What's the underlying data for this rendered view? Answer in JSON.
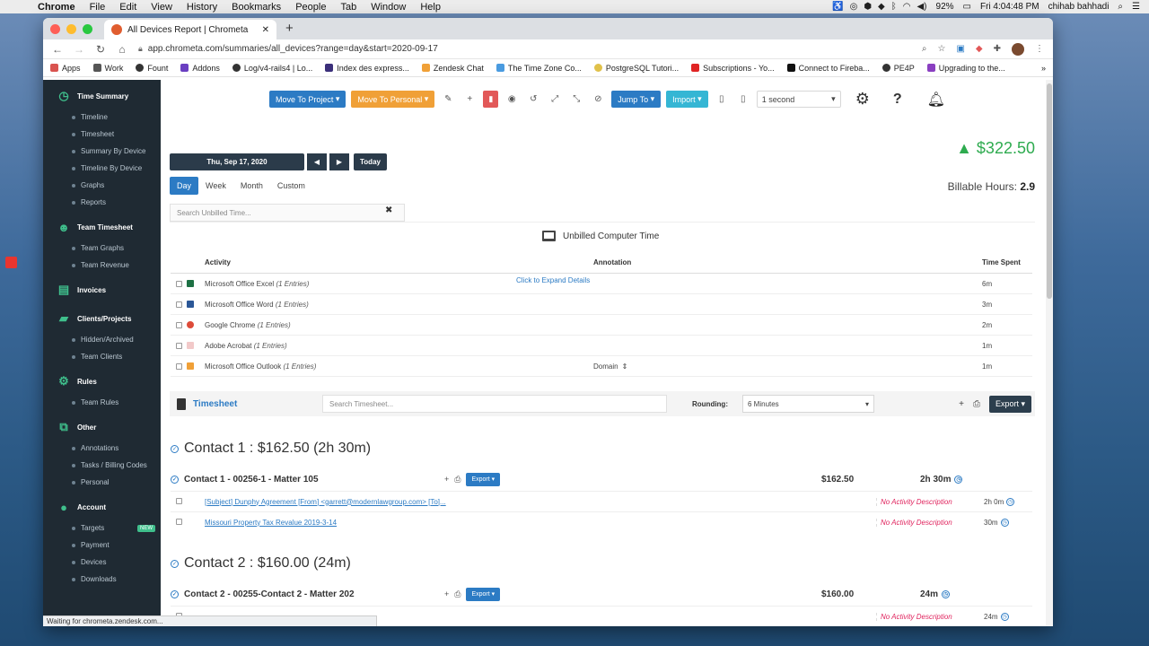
{
  "menubar": {
    "app": "Chrome",
    "items": [
      "File",
      "Edit",
      "View",
      "History",
      "Bookmarks",
      "People",
      "Tab",
      "Window",
      "Help"
    ],
    "battery": "92%",
    "clock": "Fri 4:04:48 PM",
    "user": "chihab bahhadi"
  },
  "browser": {
    "tab_title": "All Devices Report | Chrometa",
    "url": "app.chrometa.com/summaries/all_devices?range=day&start=2020-09-17",
    "bookmarks": [
      "Apps",
      "Work",
      "Fount",
      "Addons",
      "Log/v4-rails4 | Lo...",
      "Index des express...",
      "Zendesk Chat",
      "The Time Zone Co...",
      "PostgreSQL Tutori...",
      "Subscriptions - Yo...",
      "Connect to Fireba...",
      "PE4P",
      "Upgrading to the..."
    ],
    "status": "Waiting for chrometa.zendesk.com..."
  },
  "sidebar": {
    "sections": [
      {
        "title": "Time Summary",
        "icon": "clock-icon",
        "items": [
          "Timeline",
          "Timesheet",
          "Summary By Device",
          "Timeline By Device",
          "Graphs",
          "Reports"
        ]
      },
      {
        "title": "Team Timesheet",
        "icon": "team-icon",
        "items": [
          "Team Graphs",
          "Team Revenue"
        ]
      },
      {
        "title": "Invoices",
        "icon": "invoice-icon",
        "items": []
      },
      {
        "title": "Clients/Projects",
        "icon": "briefcase-icon",
        "items": [
          "Hidden/Archived",
          "Team Clients"
        ]
      },
      {
        "title": "Rules",
        "icon": "cogs-icon",
        "items": [
          "Team Rules"
        ]
      },
      {
        "title": "Other",
        "icon": "external-icon",
        "items": [
          "Annotations",
          "Tasks / Billing Codes",
          "Personal"
        ]
      },
      {
        "title": "Account",
        "icon": "user-icon",
        "items": [
          "Targets",
          "Payment",
          "Devices",
          "Downloads"
        ]
      }
    ],
    "new_badge": "NEW"
  },
  "toolbar": {
    "move_project": "Move To Project",
    "move_personal": "Move To Personal",
    "jump_to": "Jump To",
    "import": "Import",
    "interval": "1 second"
  },
  "datebar": {
    "date": "Thu, Sep 17, 2020",
    "today": "Today",
    "ranges": [
      "Day",
      "Week",
      "Month",
      "Custom"
    ]
  },
  "summary": {
    "amount": "$322.50",
    "billable_label": "Billable Hours:",
    "billable_value": "2.9"
  },
  "unbilled": {
    "search_placeholder": "Search Unbilled Time...",
    "title": "Unbilled Computer Time",
    "headers": {
      "activity": "Activity",
      "annotation": "Annotation",
      "time": "Time Spent"
    },
    "expand_link": "Click to Expand Details",
    "domain_label": "Domain",
    "rows": [
      {
        "app": "Microsoft Office Excel",
        "entries": "(1 Entries)",
        "time": "6m",
        "color": "#1d7044"
      },
      {
        "app": "Microsoft Office Word",
        "entries": "(1 Entries)",
        "time": "3m",
        "color": "#2b5797"
      },
      {
        "app": "Google Chrome",
        "entries": "(1 Entries)",
        "time": "2m",
        "color": "#dd4b39"
      },
      {
        "app": "Adobe Acrobat",
        "entries": "(1 Entries)",
        "time": "1m",
        "color": "#e02424"
      },
      {
        "app": "Microsoft Office Outlook",
        "entries": "(1 Entries)",
        "time": "1m",
        "color": "#f0a037"
      }
    ]
  },
  "timesheet": {
    "title": "Timesheet",
    "search_placeholder": "Search Timesheet...",
    "rounding_label": "Rounding:",
    "rounding_value": "6 Minutes",
    "export": "Export",
    "contacts": [
      {
        "heading": "Contact 1 : $162.50 (2h 30m)",
        "matter": "Contact 1 - 00256-1 - Matter 105",
        "amount": "$162.50",
        "duration": "2h 30m",
        "entries": [
          {
            "desc": "[Subject] Dunphy Agreement [From] <garrett@modernlawgroup.com> [To]...",
            "note": "No Activity Description",
            "duration": "2h 0m"
          },
          {
            "desc": "Missouri Property Tax Revalue 2019-3-14",
            "note": "No Activity Description",
            "duration": "30m"
          }
        ]
      },
      {
        "heading": "Contact 2 : $160.00 (24m)",
        "matter": "Contact 2 - 00255-Contact 2 - Matter 202",
        "amount": "$160.00",
        "duration": "24m",
        "entries": [
          {
            "desc": "",
            "note": "No Activity Description",
            "duration": "24m"
          }
        ]
      }
    ]
  }
}
